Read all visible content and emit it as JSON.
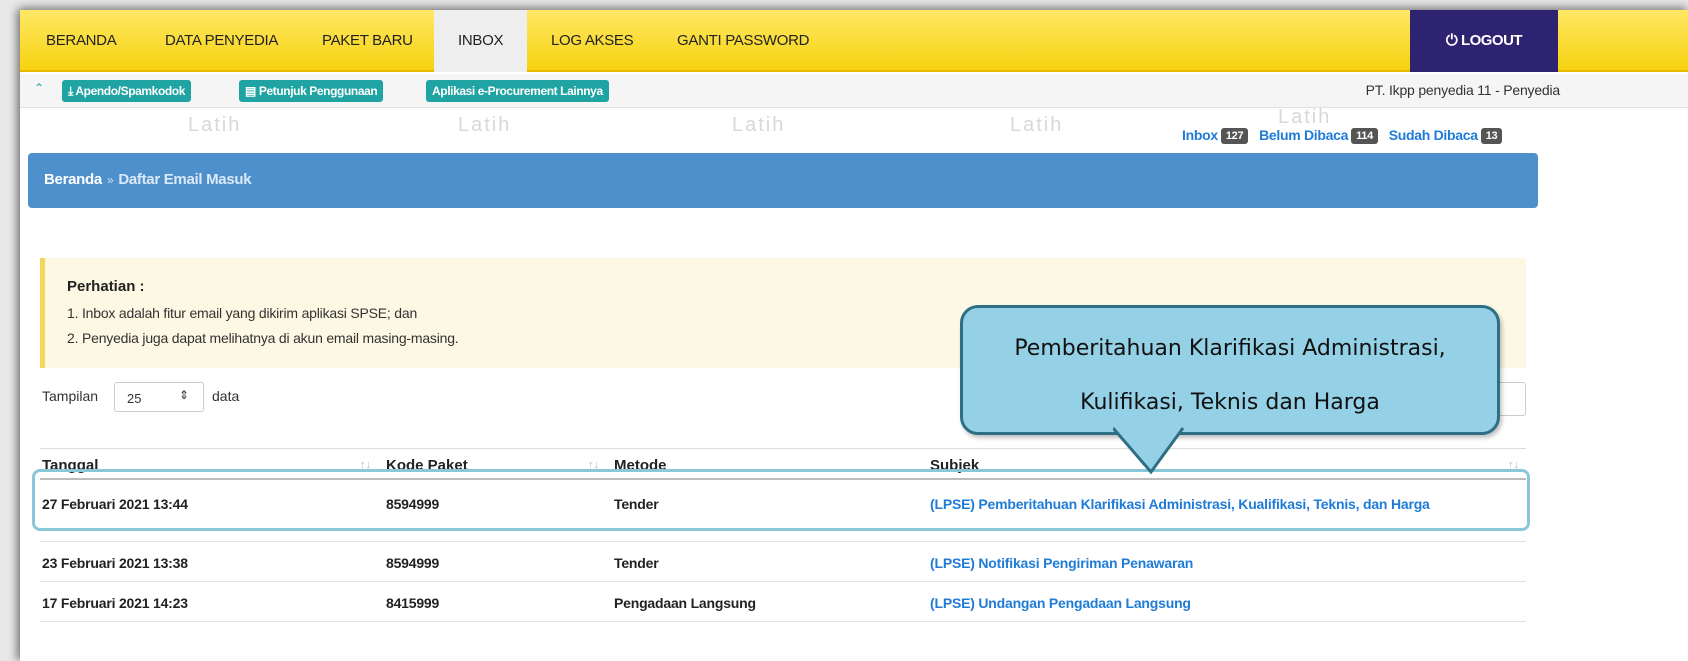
{
  "nav": {
    "items": [
      "BERANDA",
      "DATA PENYEDIA",
      "PAKET BARU",
      "INBOX",
      "LOG AKSES",
      "GANTI PASSWORD"
    ],
    "active": "INBOX",
    "logout_label": "LOGOUT"
  },
  "toolbar": {
    "buttons": [
      "Apendo/Spamkodok",
      "Petunjuk Penggunaan",
      "Aplikasi e-Procurement Lainnya"
    ],
    "user": "PT. Ikpp penyedia 11 - Penyedia"
  },
  "counters": {
    "inbox_label": "Inbox",
    "inbox_count": "127",
    "unread_label": "Belum Dibaca",
    "unread_count": "114",
    "read_label": "Sudah Dibaca",
    "read_count": "13"
  },
  "breadcrumb": {
    "root": "Beranda",
    "sep": "»",
    "current": "Daftar Email Masuk"
  },
  "watermark": "Latih",
  "alert": {
    "title": "Perhatian :",
    "lines": [
      "1. Inbox adalah fitur email yang dikirim aplikasi SPSE; dan",
      "2. Penyedia juga dapat melihatnya di akun email masing-masing."
    ]
  },
  "length": {
    "prefix": "Tampilan",
    "value": "25",
    "suffix": "data"
  },
  "table": {
    "columns": [
      "Tanggal",
      "Kode Paket",
      "Metode",
      "Subjek"
    ],
    "rows": [
      {
        "tanggal": "27 Februari 2021 13:44",
        "kode": "8594999",
        "metode": "Tender",
        "subjek": "(LPSE) Pemberitahuan Klarifikasi Administrasi, Kualifikasi, Teknis, dan Harga"
      },
      {
        "tanggal": "23 Februari 2021 13:38",
        "kode": "8594999",
        "metode": "Tender",
        "subjek": "(LPSE) Notifikasi Pengiriman Penawaran"
      },
      {
        "tanggal": "17 Februari 2021 14:23",
        "kode": "8415999",
        "metode": "Pengadaan Langsung",
        "subjek": "(LPSE) Undangan Pengadaan Langsung"
      }
    ]
  },
  "callout": {
    "line1": "Pemberitahuan Klarifikasi Administrasi,",
    "line2": "Kulifikasi, Teknis dan Harga"
  },
  "colors": {
    "nav_bg": "#f6d20e",
    "logout_bg": "#2d2370",
    "accent": "#1fa3a3",
    "breadcrumb_bg": "#4d90cc",
    "link": "#1e7cd8",
    "callout_bg": "#94d1e6"
  }
}
